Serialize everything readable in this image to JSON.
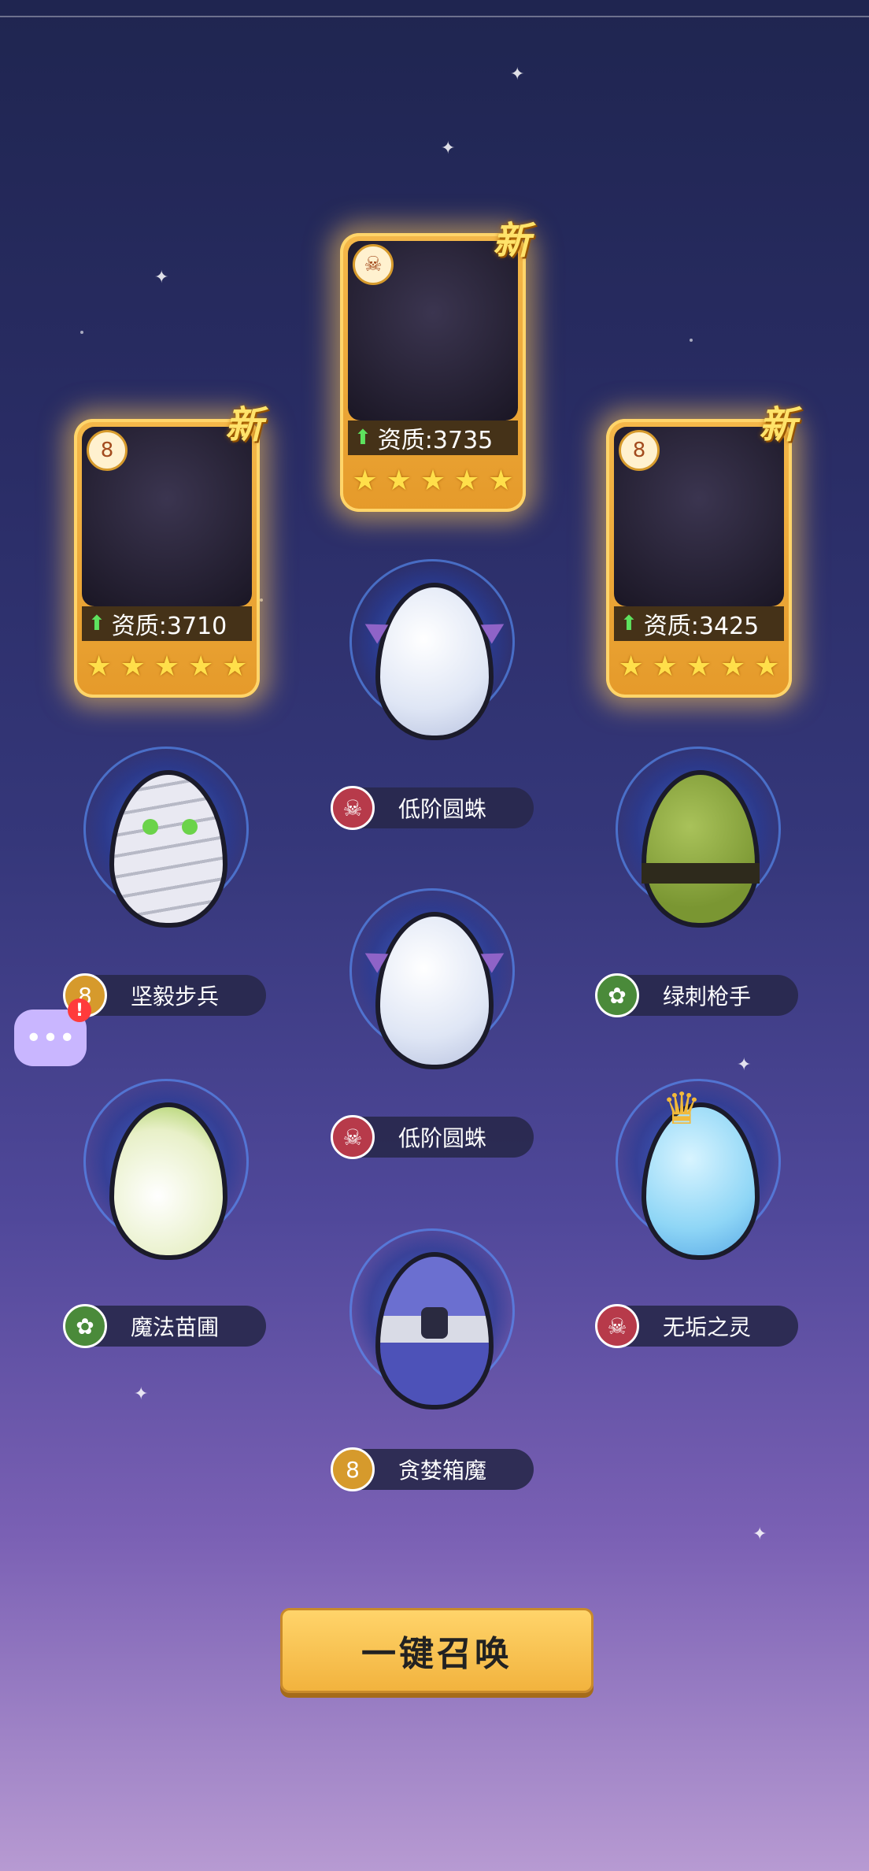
{
  "new_label": "新",
  "cards": [
    {
      "name": "card-left",
      "quality_label": "资质:3710",
      "stars": 5,
      "faction": "8"
    },
    {
      "name": "card-center",
      "quality_label": "资质:3735",
      "stars": 5,
      "faction": "☠"
    },
    {
      "name": "card-right",
      "quality_label": "资质:3425",
      "stars": 5,
      "faction": "8"
    }
  ],
  "eggs": {
    "e1": {
      "label": "低阶圆蛛",
      "faction": "☠"
    },
    "e2": {
      "label": "坚毅步兵",
      "faction": "8"
    },
    "e3": {
      "label": "绿刺枪手",
      "faction": "✿"
    },
    "e4": {
      "label": "低阶圆蛛",
      "faction": "☠"
    },
    "e5": {
      "label": "魔法苗圃",
      "faction": "✿"
    },
    "e6": {
      "label": "无垢之灵",
      "faction": "☠"
    },
    "e7": {
      "label": "贪婪箱魔",
      "faction": "8"
    }
  },
  "colors": {
    "gold": "#f4b84a",
    "bronze": "#d69a2c",
    "green": "#4a8a3a",
    "red": "#b73a4a",
    "button": "#f2b33e"
  },
  "summon_button": "一键召唤"
}
